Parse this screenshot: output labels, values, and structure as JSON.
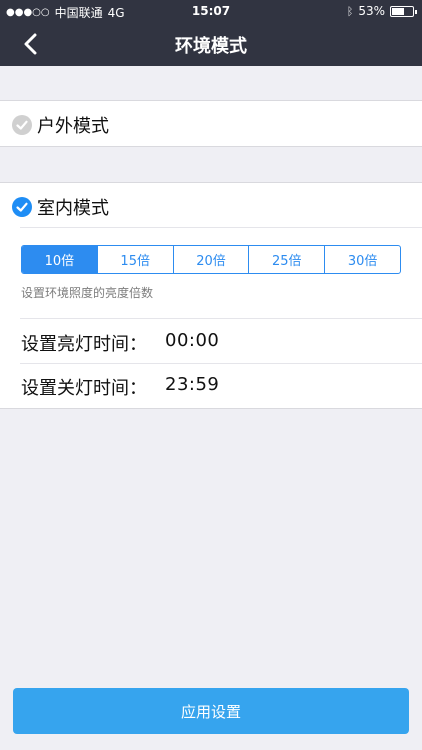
{
  "status_bar": {
    "carrier": "中国联通",
    "network": "4G",
    "time": "15:07",
    "battery": "53%"
  },
  "nav": {
    "title": "环境模式"
  },
  "modes": {
    "outdoor": {
      "label": "户外模式",
      "selected": false
    },
    "indoor": {
      "label": "室内模式",
      "selected": true
    }
  },
  "brightness": {
    "options": [
      "10倍",
      "15倍",
      "20倍",
      "25倍",
      "30倍"
    ],
    "selected_index": 0,
    "hint": "设置环境照度的亮度倍数"
  },
  "schedule": {
    "on_label": "设置亮灯时间：",
    "on_value": "00:00",
    "off_label": "设置关灯时间：",
    "off_value": "23:59"
  },
  "apply_button": {
    "label": "应用设置"
  },
  "colors": {
    "header_bg": "#313441",
    "accent": "#2d8cf0",
    "button": "#36a4ee",
    "page_bg": "#efeff4"
  }
}
